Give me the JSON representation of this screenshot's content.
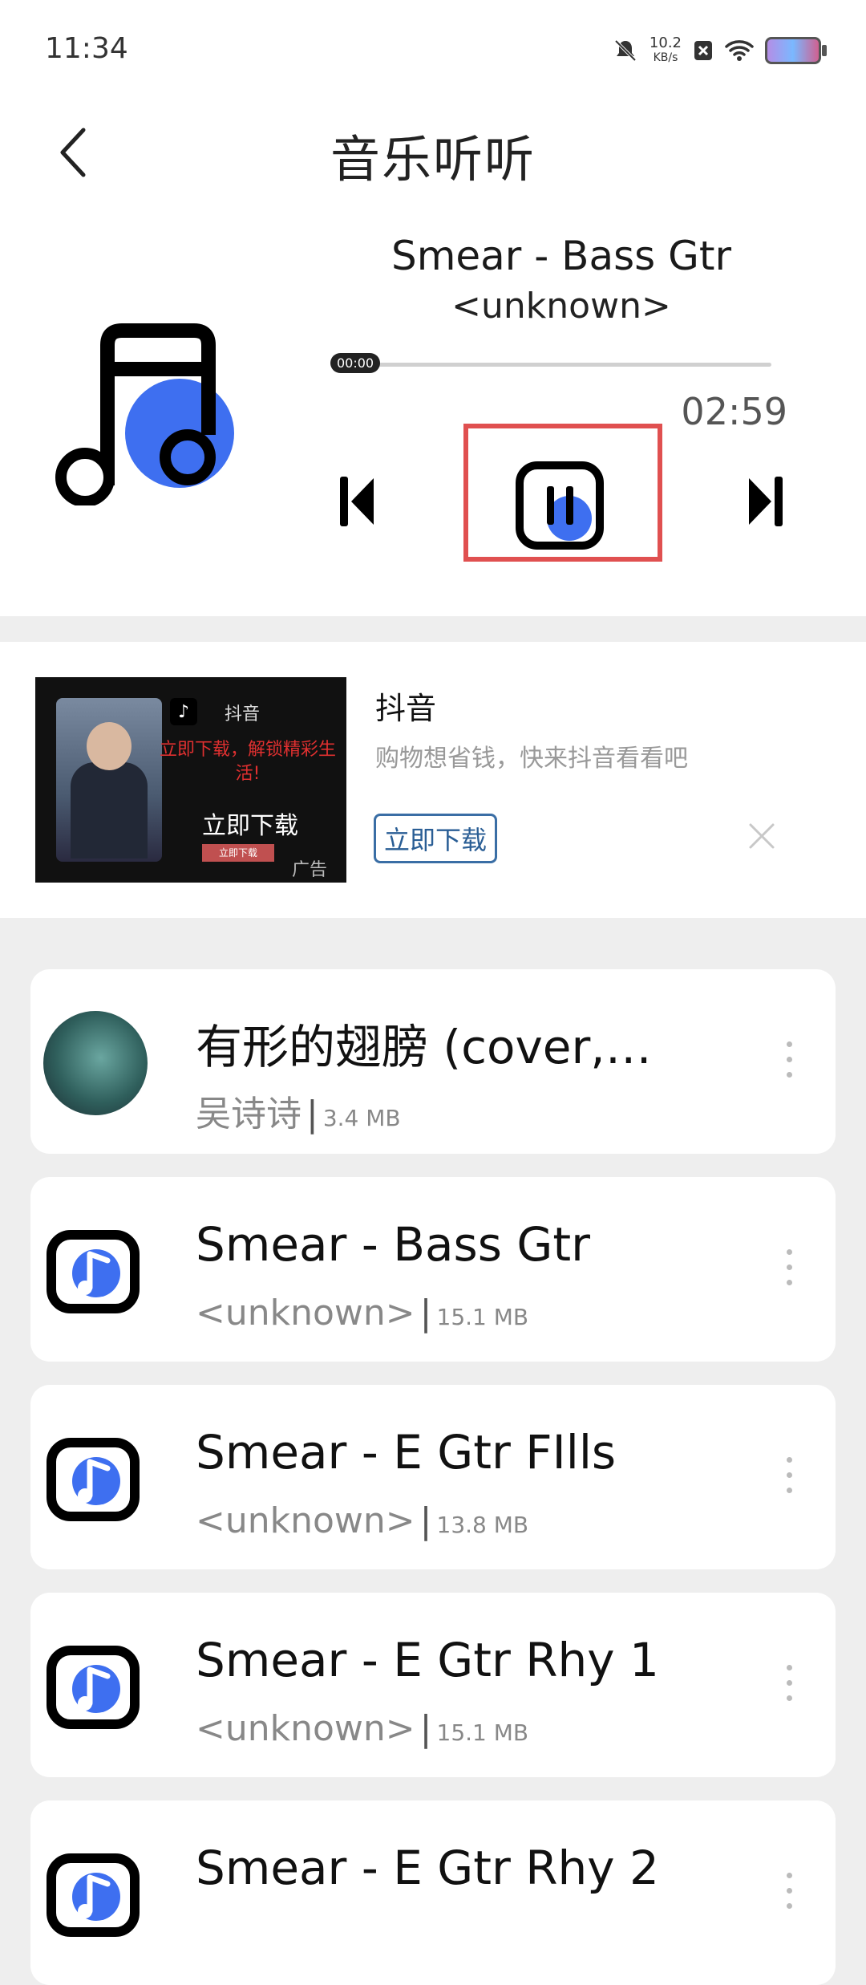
{
  "status_bar": {
    "time": "11:34",
    "net_speed": "10.2",
    "net_unit": "KB/s"
  },
  "header": {
    "title": "音乐听听"
  },
  "player": {
    "song_title": "Smear - Bass Gtr",
    "artist": "<unknown>",
    "position": "00:00",
    "duration": "02:59",
    "progress": 0,
    "accent_color": "#3e6ff0"
  },
  "ad": {
    "image": {
      "app_label": "抖音",
      "promo_text": "立即下载，解锁精彩生活!",
      "download_text": "立即下载",
      "small_button": "立即下载",
      "ad_tag": "广告"
    },
    "name": "抖音",
    "description": "购物想省钱，快来抖音看看吧",
    "download_button": "立即下载"
  },
  "songs": [
    {
      "title": "有形的翅膀 (cover,…",
      "artist": "吴诗诗",
      "size": "3.4 MB",
      "art": "avatar"
    },
    {
      "title": "Smear - Bass Gtr",
      "artist": "<unknown>",
      "size": "15.1 MB",
      "art": "music-note-icon"
    },
    {
      "title": "Smear - E Gtr FIlls",
      "artist": "<unknown>",
      "size": "13.8 MB",
      "art": "music-note-icon"
    },
    {
      "title": "Smear - E Gtr Rhy 1",
      "artist": "<unknown>",
      "size": "15.1 MB",
      "art": "music-note-icon"
    },
    {
      "title": "Smear - E Gtr Rhy 2",
      "artist": "",
      "size": "",
      "art": "music-note-icon"
    }
  ],
  "separator": "|"
}
